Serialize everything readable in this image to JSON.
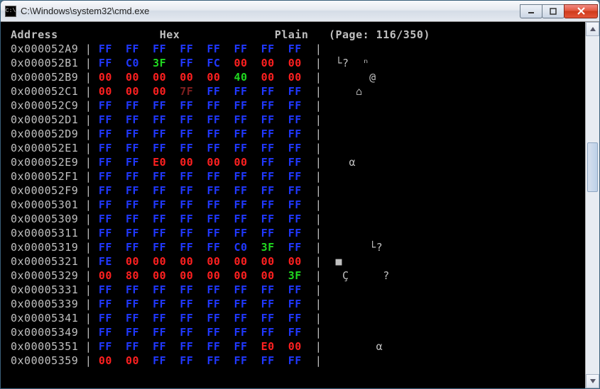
{
  "window": {
    "title": "C:\\Windows\\system32\\cmd.exe",
    "icon_label": "cmd-icon"
  },
  "header": {
    "address": "Address",
    "hex": "Hex",
    "plain": "Plain",
    "page_label": "(Page: 116/350)",
    "page_current": 116,
    "page_total": 350
  },
  "rows": [
    {
      "addr": "0x000052A9",
      "bytes": [
        "FF",
        "FF",
        "FF",
        "FF",
        "FF",
        "FF",
        "FF",
        "FF"
      ],
      "plain": ""
    },
    {
      "addr": "0x000052B1",
      "bytes": [
        "FF",
        "C0",
        "3F",
        "FF",
        "FC",
        "00",
        "00",
        "00"
      ],
      "plain": "└?  ⁿ"
    },
    {
      "addr": "0x000052B9",
      "bytes": [
        "00",
        "00",
        "00",
        "00",
        "00",
        "40",
        "00",
        "00"
      ],
      "plain": "     @"
    },
    {
      "addr": "0x000052C1",
      "bytes": [
        "00",
        "00",
        "00",
        "7F",
        "FF",
        "FF",
        "FF",
        "FF"
      ],
      "plain": "   ⌂"
    },
    {
      "addr": "0x000052C9",
      "bytes": [
        "FF",
        "FF",
        "FF",
        "FF",
        "FF",
        "FF",
        "FF",
        "FF"
      ],
      "plain": ""
    },
    {
      "addr": "0x000052D1",
      "bytes": [
        "FF",
        "FF",
        "FF",
        "FF",
        "FF",
        "FF",
        "FF",
        "FF"
      ],
      "plain": ""
    },
    {
      "addr": "0x000052D9",
      "bytes": [
        "FF",
        "FF",
        "FF",
        "FF",
        "FF",
        "FF",
        "FF",
        "FF"
      ],
      "plain": ""
    },
    {
      "addr": "0x000052E1",
      "bytes": [
        "FF",
        "FF",
        "FF",
        "FF",
        "FF",
        "FF",
        "FF",
        "FF"
      ],
      "plain": ""
    },
    {
      "addr": "0x000052E9",
      "bytes": [
        "FF",
        "FF",
        "E0",
        "00",
        "00",
        "00",
        "FF",
        "FF"
      ],
      "plain": "  α"
    },
    {
      "addr": "0x000052F1",
      "bytes": [
        "FF",
        "FF",
        "FF",
        "FF",
        "FF",
        "FF",
        "FF",
        "FF"
      ],
      "plain": ""
    },
    {
      "addr": "0x000052F9",
      "bytes": [
        "FF",
        "FF",
        "FF",
        "FF",
        "FF",
        "FF",
        "FF",
        "FF"
      ],
      "plain": ""
    },
    {
      "addr": "0x00005301",
      "bytes": [
        "FF",
        "FF",
        "FF",
        "FF",
        "FF",
        "FF",
        "FF",
        "FF"
      ],
      "plain": ""
    },
    {
      "addr": "0x00005309",
      "bytes": [
        "FF",
        "FF",
        "FF",
        "FF",
        "FF",
        "FF",
        "FF",
        "FF"
      ],
      "plain": ""
    },
    {
      "addr": "0x00005311",
      "bytes": [
        "FF",
        "FF",
        "FF",
        "FF",
        "FF",
        "FF",
        "FF",
        "FF"
      ],
      "plain": ""
    },
    {
      "addr": "0x00005319",
      "bytes": [
        "FF",
        "FF",
        "FF",
        "FF",
        "FF",
        "C0",
        "3F",
        "FF"
      ],
      "plain": "     └?"
    },
    {
      "addr": "0x00005321",
      "bytes": [
        "FE",
        "00",
        "00",
        "00",
        "00",
        "00",
        "00",
        "00"
      ],
      "plain": "■"
    },
    {
      "addr": "0x00005329",
      "bytes": [
        "00",
        "80",
        "00",
        "00",
        "00",
        "00",
        "00",
        "3F"
      ],
      "plain": " Ç     ?"
    },
    {
      "addr": "0x00005331",
      "bytes": [
        "FF",
        "FF",
        "FF",
        "FF",
        "FF",
        "FF",
        "FF",
        "FF"
      ],
      "plain": ""
    },
    {
      "addr": "0x00005339",
      "bytes": [
        "FF",
        "FF",
        "FF",
        "FF",
        "FF",
        "FF",
        "FF",
        "FF"
      ],
      "plain": ""
    },
    {
      "addr": "0x00005341",
      "bytes": [
        "FF",
        "FF",
        "FF",
        "FF",
        "FF",
        "FF",
        "FF",
        "FF"
      ],
      "plain": ""
    },
    {
      "addr": "0x00005349",
      "bytes": [
        "FF",
        "FF",
        "FF",
        "FF",
        "FF",
        "FF",
        "FF",
        "FF"
      ],
      "plain": ""
    },
    {
      "addr": "0x00005351",
      "bytes": [
        "FF",
        "FF",
        "FF",
        "FF",
        "FF",
        "FF",
        "E0",
        "00"
      ],
      "plain": "      α"
    },
    {
      "addr": "0x00005359",
      "bytes": [
        "00",
        "00",
        "FF",
        "FF",
        "FF",
        "FF",
        "FF",
        "FF"
      ],
      "plain": ""
    }
  ],
  "colors": {
    "byte_FF": "#2038ff",
    "byte_00": "#ff2020",
    "byte_green": "#20d820",
    "byte_dark": "#802020",
    "text": "#c0c0c0"
  }
}
